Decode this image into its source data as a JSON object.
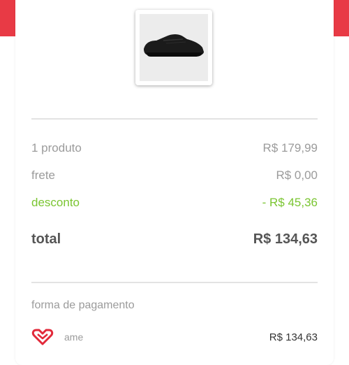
{
  "product": {
    "image_icon": "black-sneaker-photo"
  },
  "summary": {
    "products_label": "1 produto",
    "products_value": "R$ 179,99",
    "shipping_label": "frete",
    "shipping_value": "R$ 0,00",
    "discount_label": "desconto",
    "discount_value": "- R$ 45,36",
    "total_label": "total",
    "total_value": "R$ 134,63"
  },
  "payment": {
    "section_title": "forma de pagamento",
    "method_icon": "ame-heart-icon",
    "method_label": "ame",
    "amount": "R$ 134,63"
  },
  "colors": {
    "accent": "#e83a45",
    "discount": "#7ac531"
  }
}
